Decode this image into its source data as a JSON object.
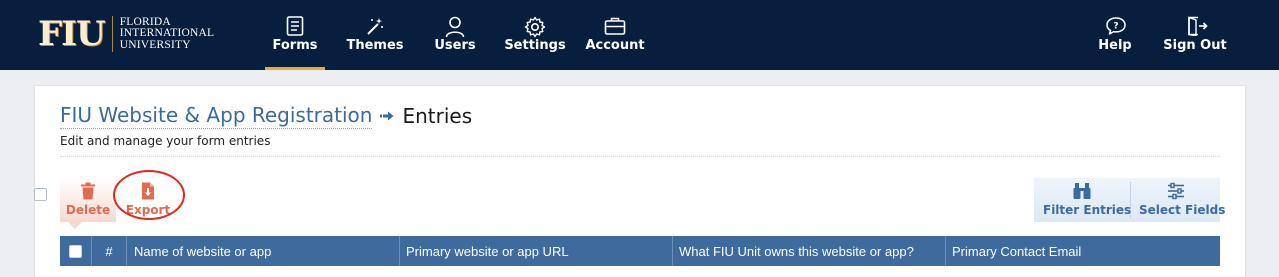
{
  "logo": {
    "mark": "FIU",
    "line1": "FLORIDA",
    "line2": "INTERNATIONAL",
    "line3": "UNIVERSITY"
  },
  "nav": {
    "forms": "Forms",
    "themes": "Themes",
    "users": "Users",
    "settings": "Settings",
    "account": "Account",
    "help": "Help",
    "sign_out": "Sign Out",
    "active": "Forms"
  },
  "page": {
    "form_name": "FIU Website & App Registration",
    "current": "Entries",
    "subtitle": "Edit and manage your form entries"
  },
  "toolbar": {
    "delete_label": "Delete",
    "export_label": "Export",
    "filter_label": "Filter Entries",
    "select_fields_label": "Select Fields"
  },
  "table": {
    "columns": [
      "#",
      "Name of website or app",
      "Primary website or app URL",
      "What FIU Unit owns this website or app?",
      "Primary Contact Email"
    ]
  },
  "colors": {
    "navbar": "#081e3f",
    "accent_gold": "#e8a83a",
    "link_blue": "#3b6aa0",
    "table_header": "#3e6a9e",
    "delete_red": "#e06b4f",
    "highlight_circle": "#e3281a"
  }
}
